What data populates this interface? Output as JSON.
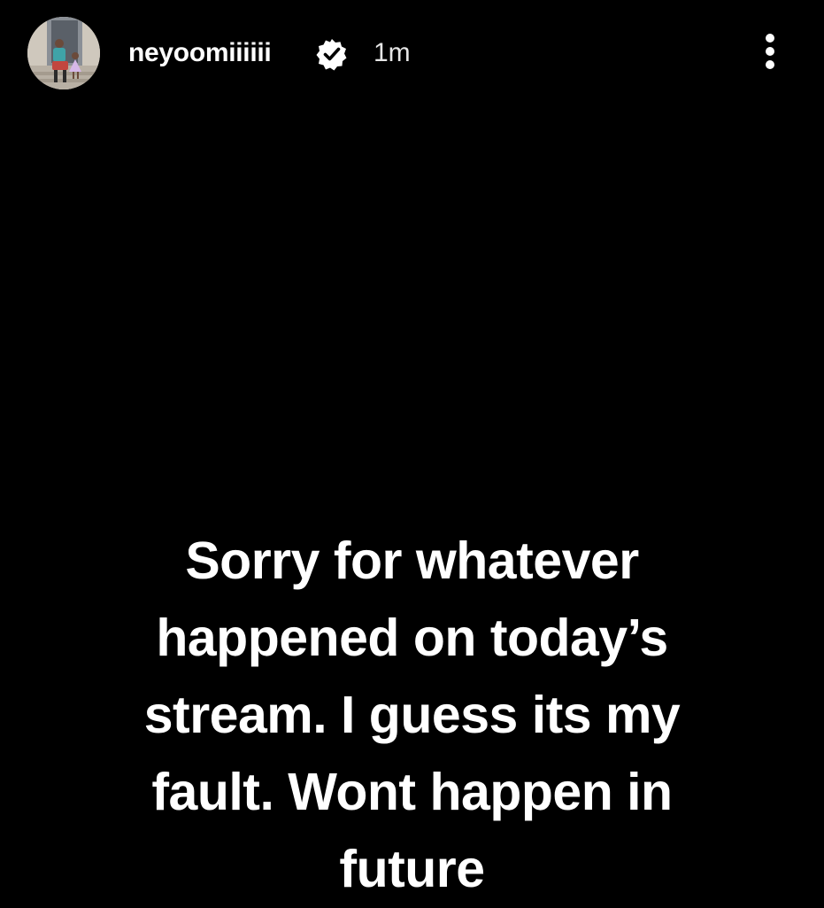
{
  "story": {
    "username": "neyoomiiiiii",
    "time_ago": "1m",
    "caption": "Sorry for whatever\nhappened on today’s\nstream. I guess its my\nfault. Wont happen in\nfuture"
  },
  "icons": {
    "verified": "verified-badge-icon",
    "more": "more-options-icon"
  },
  "colors": {
    "background": "#000000",
    "text": "#ffffff"
  }
}
